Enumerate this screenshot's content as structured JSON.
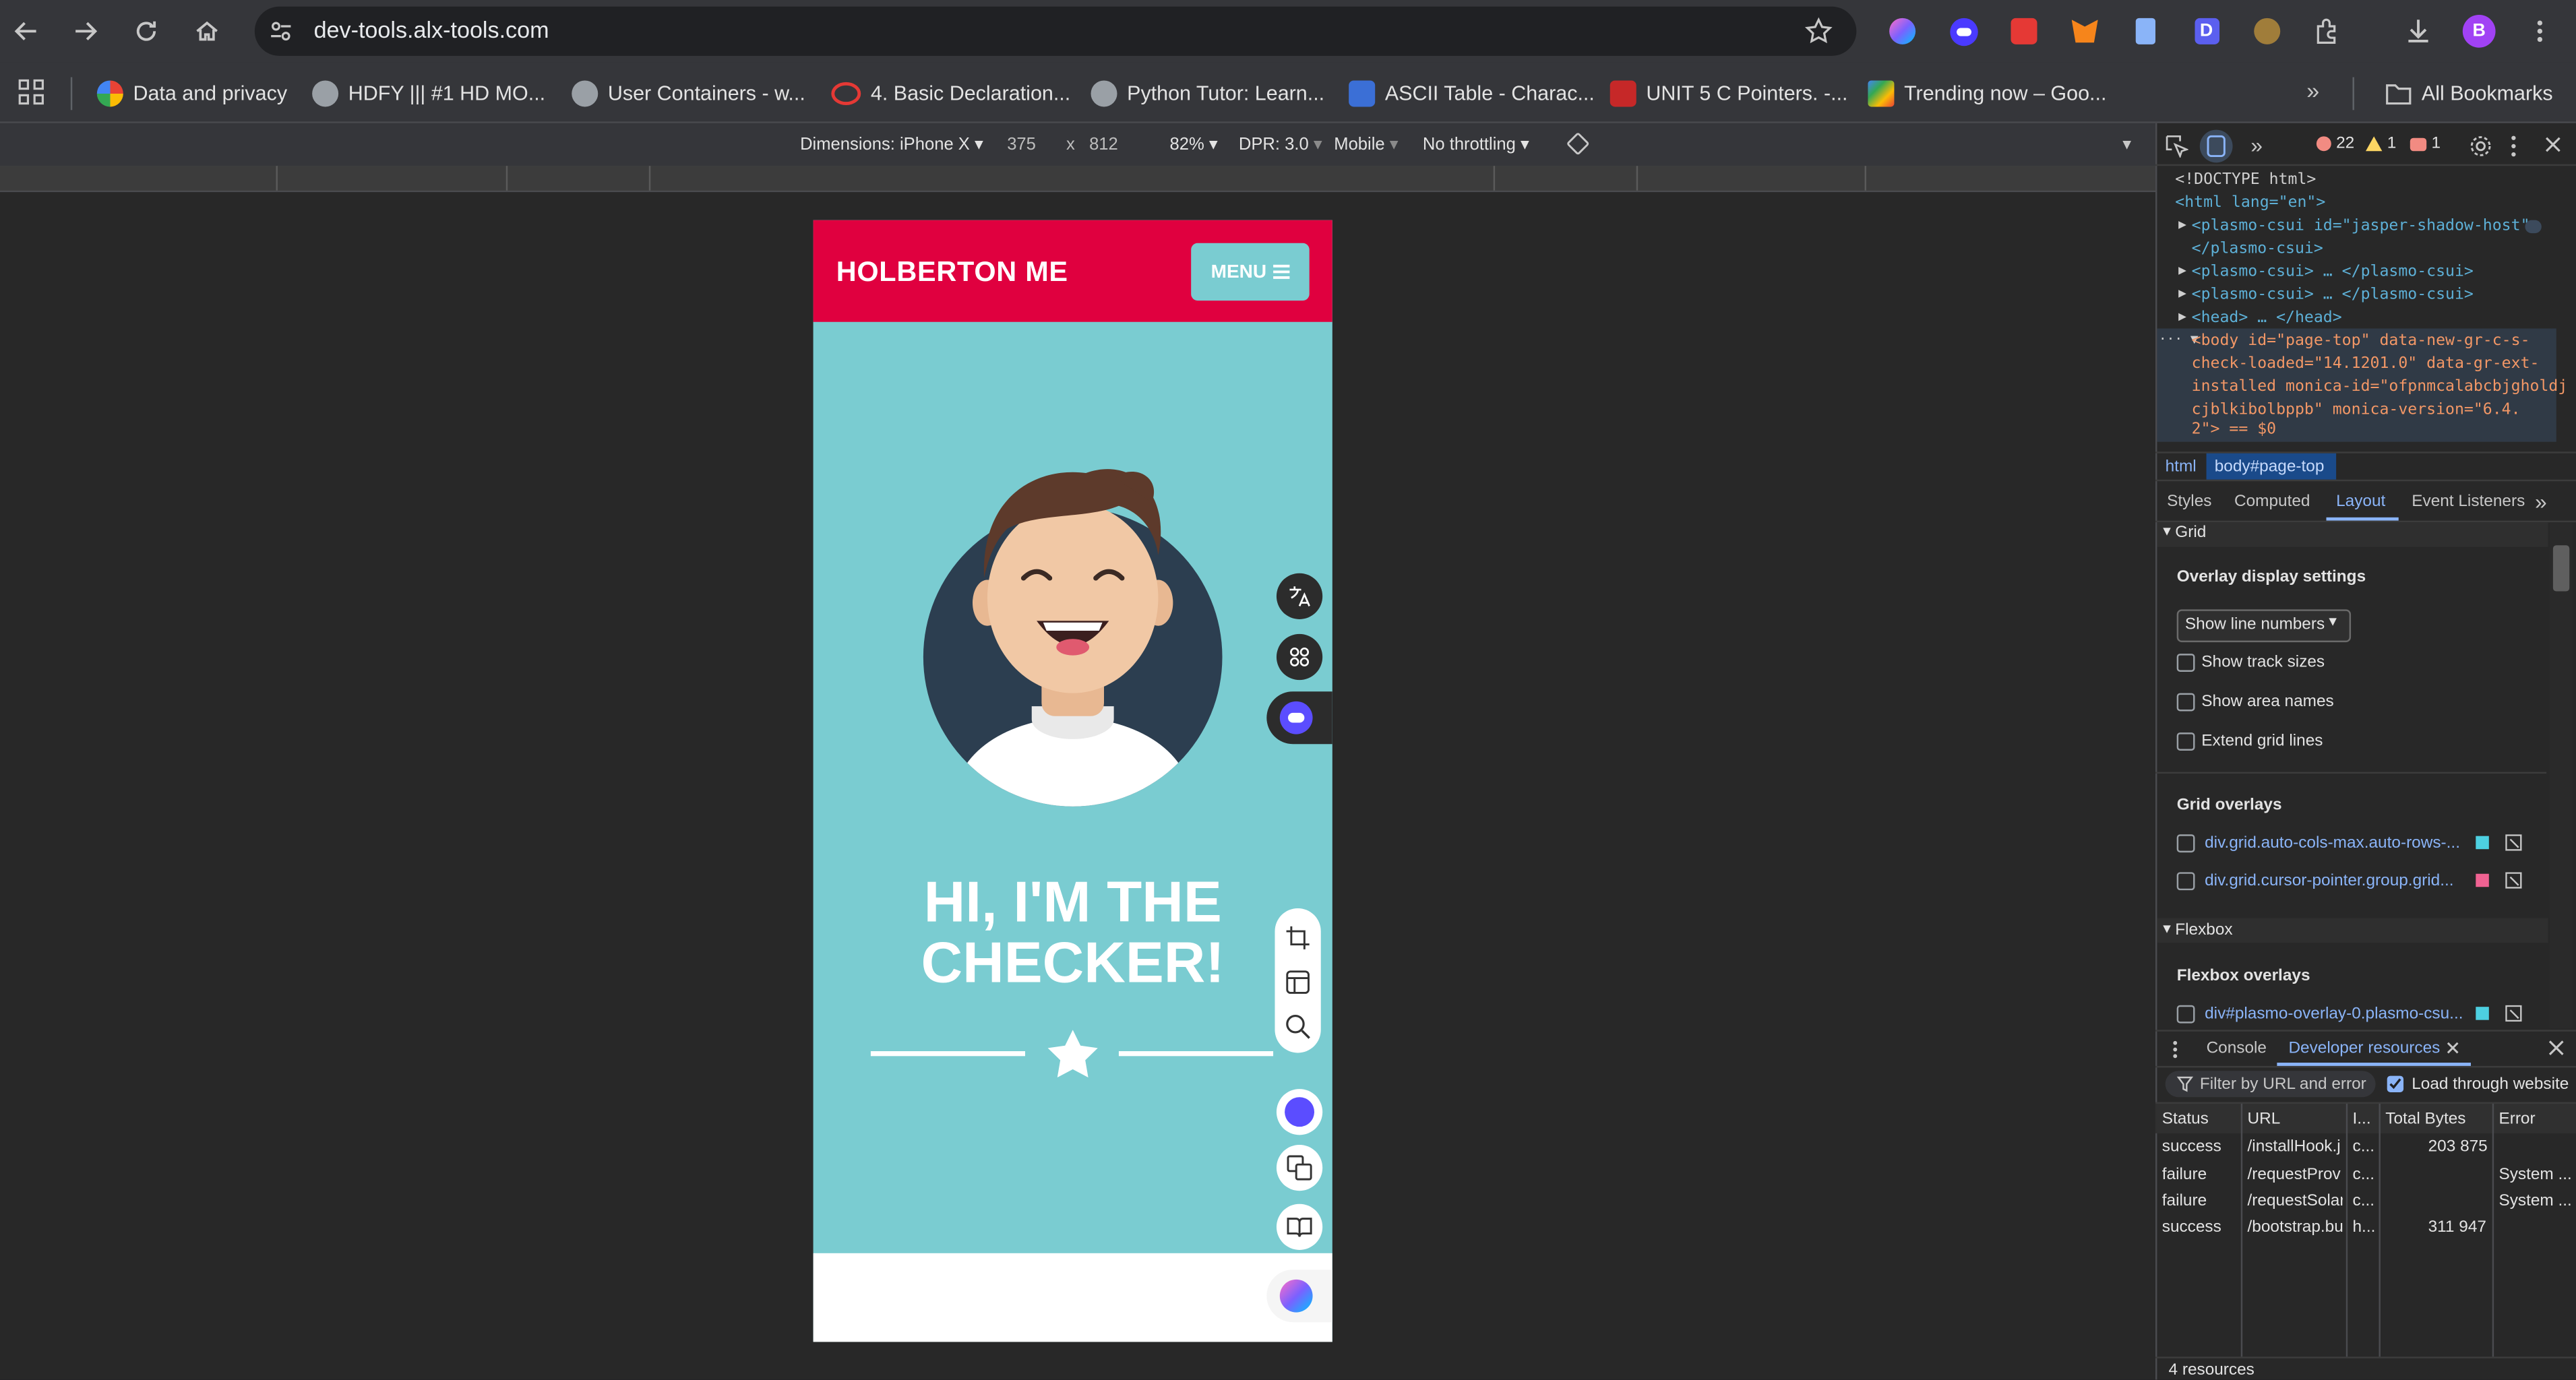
{
  "browser": {
    "url": "dev-tools.alx-tools.com",
    "profile_initial": "B",
    "bookmarks": [
      "Data and privacy",
      "HDFY ||| #1 HD MO...",
      "User Containers - w...",
      "4. Basic Declaration...",
      "Python Tutor: Learn...",
      "ASCII Table - Charac...",
      "UNIT 5 C Pointers. -...",
      "Trending now – Goo..."
    ],
    "all_bookmarks": "All Bookmarks"
  },
  "device_toolbar": {
    "dimensions": "Dimensions: iPhone X",
    "width": "375",
    "times": "x",
    "height": "812",
    "zoom": "82%",
    "dpr": "DPR: 3.0",
    "mode": "Mobile",
    "throttling": "No throttling"
  },
  "page": {
    "logo": "HOLBERTON ME",
    "menu_label": "MENU",
    "hero_title_line1": "HI, I'M THE",
    "hero_title_line2": "CHECKER!",
    "brand_color": "#e0003f",
    "hero_color": "#7accd1"
  },
  "devtools": {
    "errors": "22",
    "warnings": "1",
    "issues": "1",
    "dom": {
      "doctype": "<!DOCTYPE html>",
      "html_open": "<html lang=\"en\">",
      "csui1_open": "<plasmo-csui id=\"jasper-shadow-host\">",
      "csui1_close": "</plasmo-csui>",
      "csui2": "<plasmo-csui> … </plasmo-csui>",
      "csui3": "<plasmo-csui> … </plasmo-csui>",
      "head": "<head> … </head>",
      "body_line1": "<body id=\"page-top\" data-new-gr-c-s-",
      "body_line2": "check-loaded=\"14.1201.0\" data-gr-ext-",
      "body_line3": "installed monica-id=\"ofpnmcalabcbjgholdj",
      "body_line4": "cjblkibolbppb\" monica-version=\"6.4.",
      "body_line5": "2\"> == $0"
    },
    "breadcrumbs": [
      "html",
      "body#page-top"
    ],
    "tabs": [
      "Styles",
      "Computed",
      "Layout",
      "Event Listeners"
    ],
    "active_tab": "Layout",
    "layout": {
      "grid_heading": "Grid",
      "overlay_heading": "Overlay display settings",
      "line_select": "Show line numbers",
      "checks": [
        "Show track sizes",
        "Show area names",
        "Extend grid lines"
      ],
      "grid_overlays_heading": "Grid overlays",
      "grid_overlays": [
        {
          "label": "div.grid.auto-cols-max.auto-rows-...",
          "color": "#4dd0e1"
        },
        {
          "label": "div.grid.cursor-pointer.group.grid...",
          "color": "#f06292"
        }
      ],
      "flexbox_heading": "Flexbox",
      "flexbox_overlays_heading": "Flexbox overlays",
      "flexbox_overlays": [
        {
          "label": "div#plasmo-overlay-0.plasmo-csu...",
          "color": "#4dd0e1"
        }
      ]
    },
    "drawer": {
      "tabs": [
        "Console",
        "Developer resources"
      ],
      "filter_placeholder": "Filter by URL and error",
      "load_through": "Load through website",
      "columns": [
        "Status",
        "URL",
        "I...",
        "Total Bytes",
        "Error"
      ],
      "rows": [
        {
          "status": "success",
          "url": "/installHook.j",
          "i": "c...",
          "bytes": "203 875",
          "error": ""
        },
        {
          "status": "failure",
          "url": "/requestProv",
          "i": "c...",
          "bytes": "",
          "error": "System ..."
        },
        {
          "status": "failure",
          "url": "/requestSolar",
          "i": "c...",
          "bytes": "",
          "error": "System ..."
        },
        {
          "status": "success",
          "url": "/bootstrap.bu",
          "i": "h...",
          "bytes": "311 947",
          "error": ""
        }
      ],
      "footer": "4 resources"
    }
  }
}
